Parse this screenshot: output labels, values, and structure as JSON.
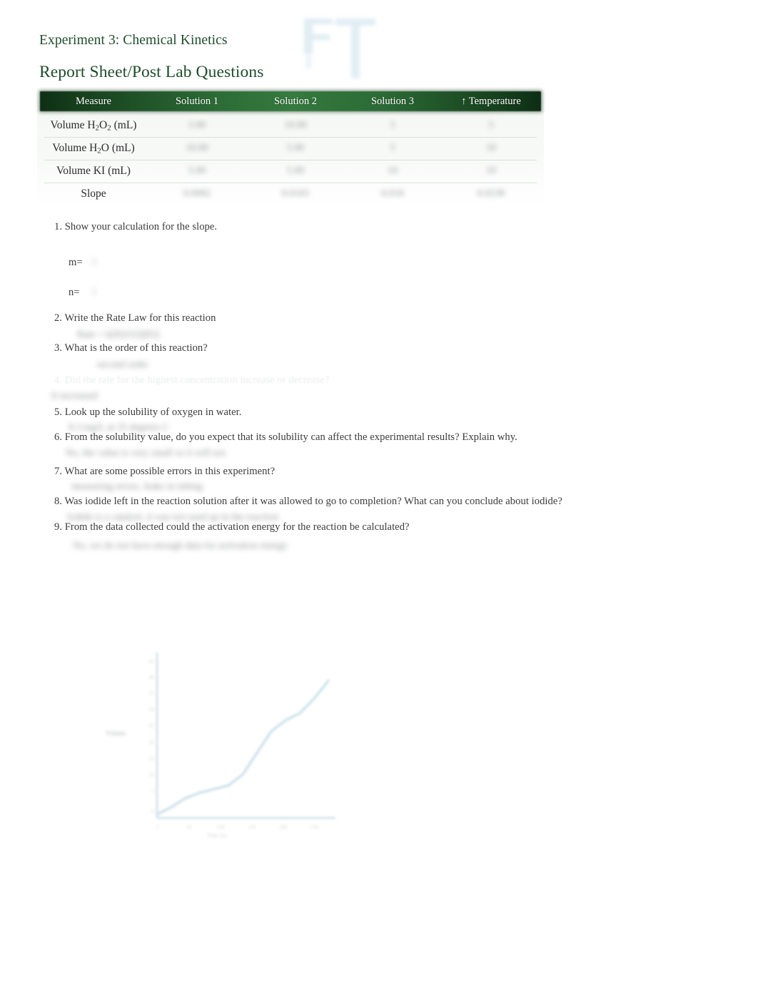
{
  "document": {
    "title": "Experiment 3: Chemical Kinetics",
    "subtitle": "Report Sheet/Post Lab Questions"
  },
  "watermark": {
    "name": "blue-logo-watermark",
    "color": "#b9d6e4"
  },
  "table": {
    "columns": [
      "Measure",
      "Solution 1",
      "Solution 2",
      "Solution 3",
      "↑ Temperature"
    ],
    "temperature_arrow": "↑",
    "header_color": "#2c6b36",
    "rows": [
      {
        "label_parts": [
          "Volume H",
          "2",
          "O",
          "2",
          " (mL)"
        ],
        "label": "Volume H2O2 (mL)",
        "values": [
          "5.00",
          "10.00",
          "5",
          "5"
        ]
      },
      {
        "label_parts": [
          "Volume H",
          "2",
          "O",
          "",
          " (mL)"
        ],
        "label": "Volume H2O (mL)",
        "values": [
          "10.00",
          "5.00",
          "5",
          "10"
        ]
      },
      {
        "label": "Volume KI (mL)",
        "values": [
          "5.00",
          "5.00",
          "10",
          "10"
        ]
      },
      {
        "label": "Slope",
        "values": [
          "0.0082",
          "0.0165",
          "0.018",
          "0.0238"
        ]
      }
    ]
  },
  "questions": [
    {
      "number": "1.",
      "text": "Show your calculation for the slope.",
      "subfields": [
        {
          "label": "m=",
          "value": "2"
        },
        {
          "label": "n=",
          "value": "1"
        }
      ],
      "answer": ""
    },
    {
      "number": "2.",
      "text": "Write the Rate Law for this reaction",
      "answer": "Rate = k[H2O2][KI]"
    },
    {
      "number": "3.",
      "text": "What is the order of this reaction?",
      "answer": "second order"
    },
    {
      "number": "4.",
      "text": "Did the rate for the highest concentration increase or decrease?",
      "answer": "It increased",
      "faded": true
    },
    {
      "number": "5.",
      "text": "Look up the solubility of oxygen in water.",
      "answer": "8.3 mg/L at 25 degrees C"
    },
    {
      "number": "6.",
      "text": "From the solubility value, do you expect that its solubility can affect the experimental results? Explain why.",
      "answer": "No, the value is very small so it will not"
    },
    {
      "number": "7.",
      "text": "What are some possible errors in this experiment?",
      "answer": "measuring errors, leaks in tubing"
    },
    {
      "number": "8.",
      "text": "Was iodide left in the reaction solution after it was allowed to go to completion? What can you conclude about iodide?",
      "answer": "Iodide is a catalyst, it was not used up in the reaction"
    },
    {
      "number": "9.",
      "text": "From the data collected could the activation energy for the reaction be calculated?",
      "answer": "No, we do not have enough data for activation energy"
    }
  ],
  "chart_data": {
    "type": "line",
    "title": "",
    "xlabel": "Time (s)",
    "ylabel": "Volume",
    "grid": false,
    "legend": false,
    "line_color": "#c7dfe8",
    "xlim": [
      0,
      250
    ],
    "ylim": [
      0,
      45
    ],
    "x_ticks": [
      "0",
      "50",
      "100",
      "150",
      "200",
      "250"
    ],
    "y_ticks": [
      "45",
      "40",
      "35",
      "30",
      "25",
      "20",
      "15",
      "10",
      "5",
      "0"
    ],
    "series": [
      {
        "name": "Volume vs Time",
        "x": [
          0,
          20,
          40,
          60,
          80,
          100,
          120,
          140,
          160,
          180,
          200,
          220,
          240
        ],
        "y": [
          1,
          3,
          5.5,
          7,
          8,
          9,
          12,
          18,
          24,
          27,
          29,
          33,
          38
        ]
      }
    ]
  }
}
